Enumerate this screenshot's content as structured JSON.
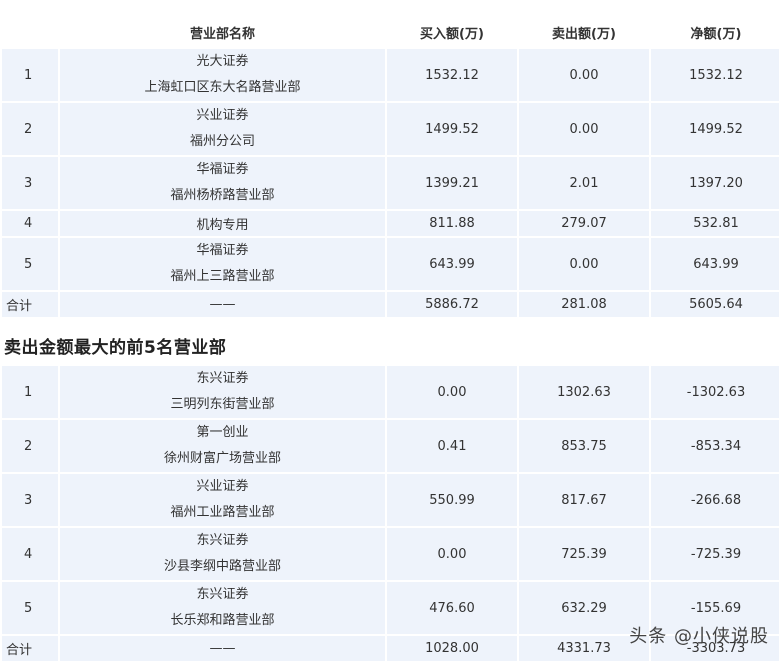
{
  "buy_table": {
    "headers": [
      "",
      "营业部名称",
      "买入额(万)",
      "卖出额(万)",
      "净额(万)"
    ],
    "rows": [
      {
        "rank": "1",
        "name1": "光大证券",
        "name2": "上海虹口区东大名路营业部",
        "buy": "1532.12",
        "sell": "0.00",
        "net": "1532.12"
      },
      {
        "rank": "2",
        "name1": "兴业证券",
        "name2": "福州分公司",
        "buy": "1499.52",
        "sell": "0.00",
        "net": "1499.52"
      },
      {
        "rank": "3",
        "name1": "华福证券",
        "name2": "福州杨桥路营业部",
        "buy": "1399.21",
        "sell": "2.01",
        "net": "1397.20"
      },
      {
        "rank": "4",
        "name1": "机构专用",
        "buy": "811.88",
        "sell": "279.07",
        "net": "532.81"
      },
      {
        "rank": "5",
        "name1": "华福证券",
        "name2": "福州上三路营业部",
        "buy": "643.99",
        "sell": "0.00",
        "net": "643.99"
      }
    ],
    "total": {
      "label": "合计",
      "name": "——",
      "buy": "5886.72",
      "sell": "281.08",
      "net": "5605.64"
    }
  },
  "sell_section_title": "卖出金额最大的前5名营业部",
  "sell_table": {
    "rows": [
      {
        "rank": "1",
        "name1": "东兴证券",
        "name2": "三明列东街营业部",
        "buy": "0.00",
        "sell": "1302.63",
        "net": "-1302.63"
      },
      {
        "rank": "2",
        "name1": "第一创业",
        "name2": "徐州财富广场营业部",
        "buy": "0.41",
        "sell": "853.75",
        "net": "-853.34"
      },
      {
        "rank": "3",
        "name1": "兴业证券",
        "name2": "福州工业路营业部",
        "buy": "550.99",
        "sell": "817.67",
        "net": "-266.68"
      },
      {
        "rank": "4",
        "name1": "东兴证券",
        "name2": "沙县李纲中路营业部",
        "buy": "0.00",
        "sell": "725.39",
        "net": "-725.39"
      },
      {
        "rank": "5",
        "name1": "东兴证券",
        "name2": "长乐郑和路营业部",
        "buy": "476.60",
        "sell": "632.29",
        "net": "-155.69"
      }
    ],
    "total": {
      "label": "合计",
      "name": "——",
      "buy": "1028.00",
      "sell": "4331.73",
      "net": "-3303.73"
    }
  },
  "watermark": "头条 @小侠说股"
}
